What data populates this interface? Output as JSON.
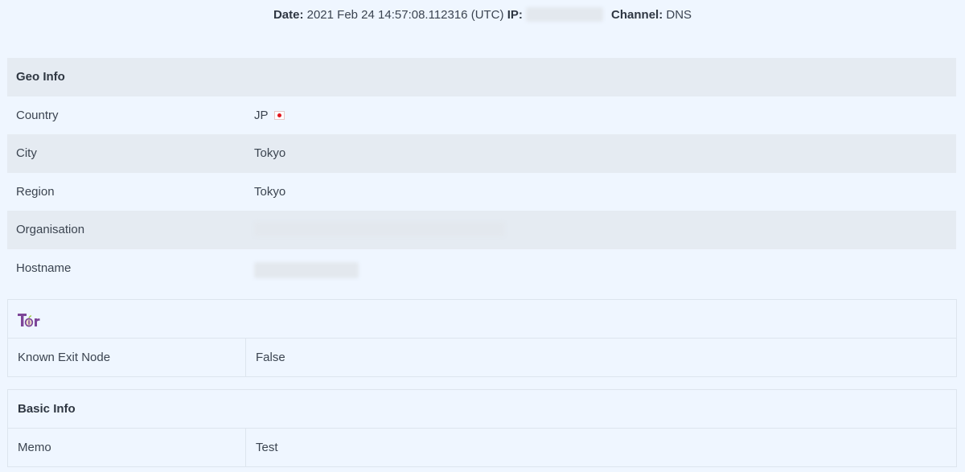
{
  "header": {
    "date_label": "Date:",
    "date_value": "2021 Feb 24 14:57:08.112316 (UTC)",
    "ip_label": "IP:",
    "channel_label": "Channel:",
    "channel_value": "DNS"
  },
  "geo": {
    "heading": "Geo Info",
    "country_label": "Country",
    "country_value": "JP",
    "country_flag": "japan-flag",
    "city_label": "City",
    "city_value": "Tokyo",
    "region_label": "Region",
    "region_value": "Tokyo",
    "organisation_label": "Organisation",
    "hostname_label": "Hostname"
  },
  "tor": {
    "logo": "Tor",
    "known_exit_label": "Known Exit Node",
    "known_exit_value": "False",
    "logo_color": "#7d4698"
  },
  "basic": {
    "heading": "Basic Info",
    "memo_label": "Memo",
    "memo_value": "Test"
  }
}
